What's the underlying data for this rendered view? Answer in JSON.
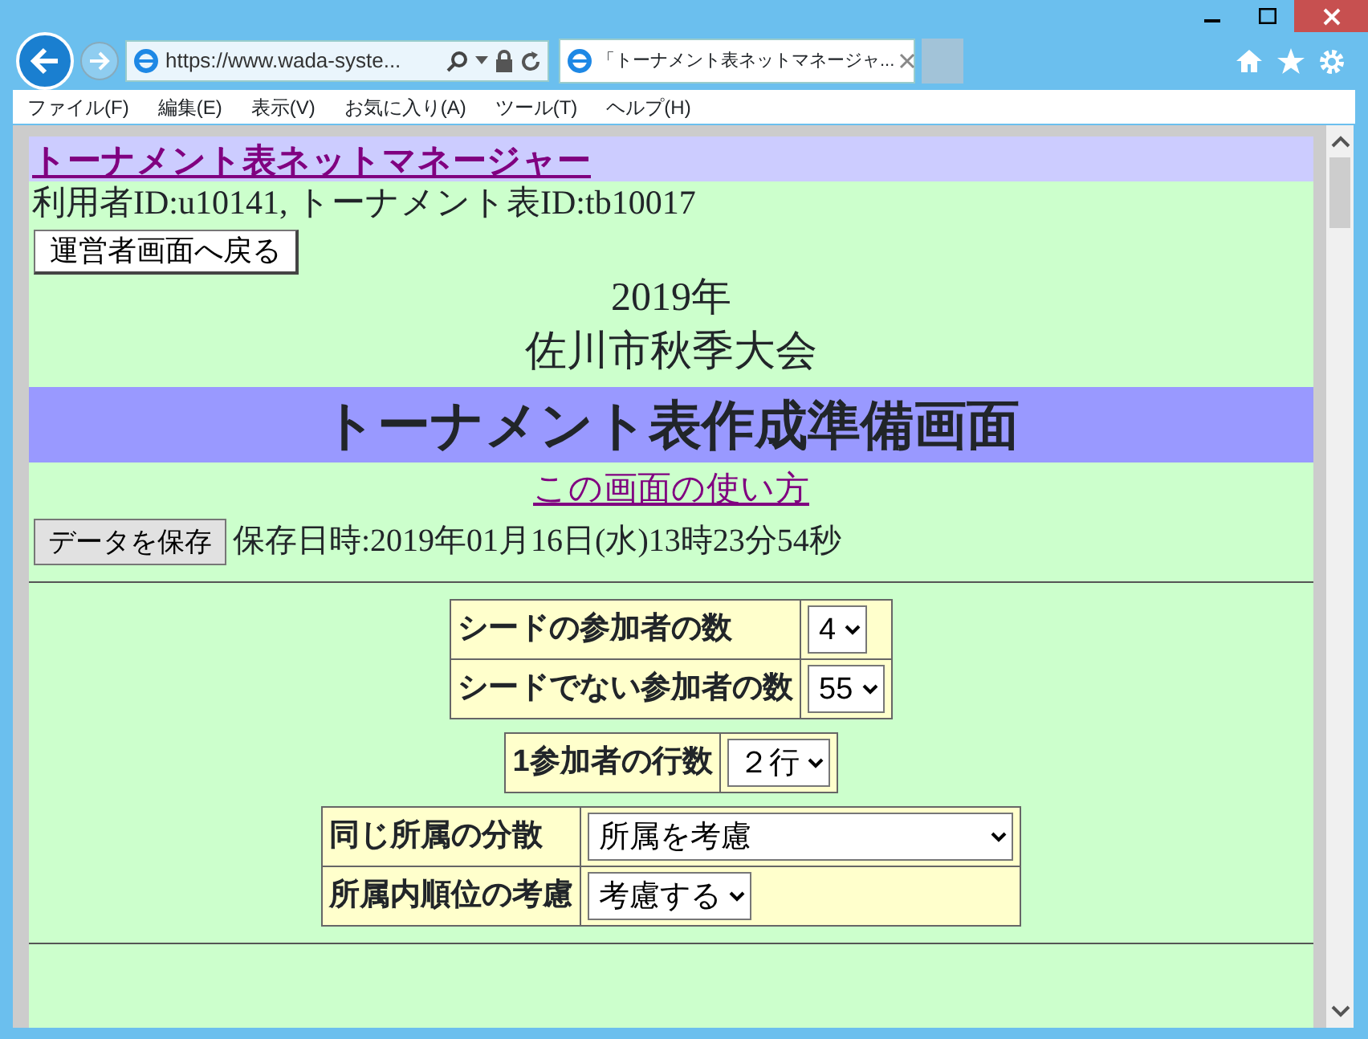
{
  "browser": {
    "address": "https://www.wada-syste...",
    "tabs": [
      {
        "title": "「トーナメント表ネットマネージャ...",
        "selected": true
      }
    ],
    "menu": [
      "ファイル(F)",
      "編集(E)",
      "表示(V)",
      "お気に入り(A)",
      "ツール(T)",
      "ヘルプ(H)"
    ]
  },
  "page": {
    "site_link": "トーナメント表ネットマネージャー",
    "ids": "利用者ID:u10141, トーナメント表ID:tb10017",
    "back_button": "運営者画面へ戻る",
    "year": "2019年",
    "event": "佐川市秋季大会",
    "banner": "トーナメント表作成準備画面",
    "help_link": "この画面の使い方",
    "save_button": "データを保存",
    "saved_at": "保存日時:2019年01月16日(水)13時23分54秒",
    "tables": [
      {
        "rows": [
          {
            "label": "シードの参加者の数",
            "value": "4"
          },
          {
            "label": "シードでない参加者の数",
            "value": "55"
          }
        ]
      },
      {
        "rows": [
          {
            "label": "1参加者の行数",
            "value": "２行"
          }
        ]
      },
      {
        "rows": [
          {
            "label": "同じ所属の分散",
            "value": "所属を考慮"
          },
          {
            "label": "所属内順位の考慮",
            "value": "考慮する"
          }
        ]
      }
    ]
  }
}
